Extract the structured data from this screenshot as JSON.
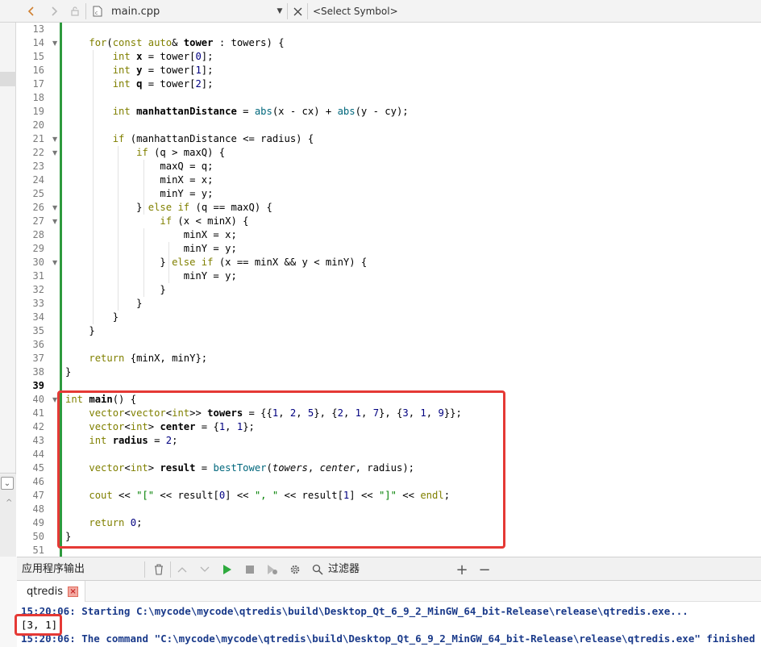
{
  "toolbar": {
    "file_name": "main.cpp",
    "symbol_placeholder": "<Select Symbol>",
    "icons": [
      "back-icon",
      "forward-icon",
      "lock-icon",
      "file-icon",
      "dropdown-icon",
      "close-icon"
    ]
  },
  "editor": {
    "current_line": 39,
    "lines": [
      {
        "n": 13,
        "fold": false
      },
      {
        "n": 14,
        "fold": true
      },
      {
        "n": 15,
        "fold": false
      },
      {
        "n": 16,
        "fold": false
      },
      {
        "n": 17,
        "fold": false
      },
      {
        "n": 18,
        "fold": false
      },
      {
        "n": 19,
        "fold": false
      },
      {
        "n": 20,
        "fold": false
      },
      {
        "n": 21,
        "fold": true
      },
      {
        "n": 22,
        "fold": true
      },
      {
        "n": 23,
        "fold": false
      },
      {
        "n": 24,
        "fold": false
      },
      {
        "n": 25,
        "fold": false
      },
      {
        "n": 26,
        "fold": true
      },
      {
        "n": 27,
        "fold": true
      },
      {
        "n": 28,
        "fold": false
      },
      {
        "n": 29,
        "fold": false
      },
      {
        "n": 30,
        "fold": true
      },
      {
        "n": 31,
        "fold": false
      },
      {
        "n": 32,
        "fold": false
      },
      {
        "n": 33,
        "fold": false
      },
      {
        "n": 34,
        "fold": false
      },
      {
        "n": 35,
        "fold": false
      },
      {
        "n": 36,
        "fold": false
      },
      {
        "n": 37,
        "fold": false
      },
      {
        "n": 38,
        "fold": false
      },
      {
        "n": 39,
        "fold": false
      },
      {
        "n": 40,
        "fold": true
      },
      {
        "n": 41,
        "fold": false
      },
      {
        "n": 42,
        "fold": false
      },
      {
        "n": 43,
        "fold": false
      },
      {
        "n": 44,
        "fold": false
      },
      {
        "n": 45,
        "fold": false
      },
      {
        "n": 46,
        "fold": false
      },
      {
        "n": 47,
        "fold": false
      },
      {
        "n": 48,
        "fold": false
      },
      {
        "n": 49,
        "fold": false
      },
      {
        "n": 50,
        "fold": false
      },
      {
        "n": 51,
        "fold": false
      }
    ],
    "code": [
      {
        "indent": 0,
        "tokens": []
      },
      {
        "indent": 4,
        "tokens": [
          [
            "kw",
            "for"
          ],
          [
            "",
            "("
          ],
          [
            "kw",
            "const"
          ],
          [
            "",
            " "
          ],
          [
            "kw",
            "auto"
          ],
          [
            "",
            "& "
          ],
          [
            "b",
            "tower"
          ],
          [
            "",
            " : towers) {"
          ]
        ]
      },
      {
        "indent": 8,
        "tokens": [
          [
            "ty",
            "int"
          ],
          [
            "",
            " "
          ],
          [
            "b",
            "x"
          ],
          [
            "",
            " = tower["
          ],
          [
            "num",
            "0"
          ],
          [
            "",
            "];"
          ]
        ]
      },
      {
        "indent": 8,
        "tokens": [
          [
            "ty",
            "int"
          ],
          [
            "",
            " "
          ],
          [
            "b",
            "y"
          ],
          [
            "",
            " = tower["
          ],
          [
            "num",
            "1"
          ],
          [
            "",
            "];"
          ]
        ]
      },
      {
        "indent": 8,
        "tokens": [
          [
            "ty",
            "int"
          ],
          [
            "",
            " "
          ],
          [
            "b",
            "q"
          ],
          [
            "",
            " = tower["
          ],
          [
            "num",
            "2"
          ],
          [
            "",
            "];"
          ]
        ]
      },
      {
        "indent": 0,
        "tokens": []
      },
      {
        "indent": 8,
        "tokens": [
          [
            "ty",
            "int"
          ],
          [
            "",
            " "
          ],
          [
            "b",
            "manhattanDistance"
          ],
          [
            "",
            " = "
          ],
          [
            "fn",
            "abs"
          ],
          [
            "",
            "(x - cx) + "
          ],
          [
            "fn",
            "abs"
          ],
          [
            "",
            "(y - cy);"
          ]
        ]
      },
      {
        "indent": 0,
        "tokens": []
      },
      {
        "indent": 8,
        "tokens": [
          [
            "kw",
            "if"
          ],
          [
            "",
            " (manhattanDistance <= radius) {"
          ]
        ]
      },
      {
        "indent": 12,
        "tokens": [
          [
            "kw",
            "if"
          ],
          [
            "",
            " (q > maxQ) {"
          ]
        ]
      },
      {
        "indent": 16,
        "tokens": [
          [
            "",
            "maxQ = q;"
          ]
        ]
      },
      {
        "indent": 16,
        "tokens": [
          [
            "",
            "minX = x;"
          ]
        ]
      },
      {
        "indent": 16,
        "tokens": [
          [
            "",
            "minY = y;"
          ]
        ]
      },
      {
        "indent": 12,
        "tokens": [
          [
            "",
            "} "
          ],
          [
            "kw",
            "else"
          ],
          [
            "",
            " "
          ],
          [
            "kw",
            "if"
          ],
          [
            "",
            " (q == maxQ) {"
          ]
        ]
      },
      {
        "indent": 16,
        "tokens": [
          [
            "kw",
            "if"
          ],
          [
            "",
            " (x < minX) {"
          ]
        ]
      },
      {
        "indent": 20,
        "tokens": [
          [
            "",
            "minX = x;"
          ]
        ]
      },
      {
        "indent": 20,
        "tokens": [
          [
            "",
            "minY = y;"
          ]
        ]
      },
      {
        "indent": 16,
        "tokens": [
          [
            "",
            "} "
          ],
          [
            "kw",
            "else"
          ],
          [
            "",
            " "
          ],
          [
            "kw",
            "if"
          ],
          [
            "",
            " (x == minX && y < minY) {"
          ]
        ]
      },
      {
        "indent": 20,
        "tokens": [
          [
            "",
            "minY = y;"
          ]
        ]
      },
      {
        "indent": 16,
        "tokens": [
          [
            "",
            "}"
          ]
        ]
      },
      {
        "indent": 12,
        "tokens": [
          [
            "",
            "}"
          ]
        ]
      },
      {
        "indent": 8,
        "tokens": [
          [
            "",
            "}"
          ]
        ]
      },
      {
        "indent": 4,
        "tokens": [
          [
            "",
            "}"
          ]
        ]
      },
      {
        "indent": 0,
        "tokens": []
      },
      {
        "indent": 4,
        "tokens": [
          [
            "kw",
            "return"
          ],
          [
            "",
            " {minX, minY};"
          ]
        ]
      },
      {
        "indent": 0,
        "tokens": [
          [
            "",
            "}"
          ]
        ]
      },
      {
        "indent": 0,
        "tokens": []
      },
      {
        "indent": 0,
        "tokens": [
          [
            "ty",
            "int"
          ],
          [
            "",
            " "
          ],
          [
            "b",
            "main"
          ],
          [
            "",
            "() {"
          ]
        ]
      },
      {
        "indent": 4,
        "tokens": [
          [
            "ty",
            "vector"
          ],
          [
            "",
            "<"
          ],
          [
            "ty",
            "vector"
          ],
          [
            "",
            "<"
          ],
          [
            "ty",
            "int"
          ],
          [
            "",
            ">> "
          ],
          [
            "b",
            "towers"
          ],
          [
            "",
            " = {{"
          ],
          [
            "num",
            "1"
          ],
          [
            "",
            ", "
          ],
          [
            "num",
            "2"
          ],
          [
            "",
            ", "
          ],
          [
            "num",
            "5"
          ],
          [
            "",
            "}, {"
          ],
          [
            "num",
            "2"
          ],
          [
            "",
            ", "
          ],
          [
            "num",
            "1"
          ],
          [
            "",
            ", "
          ],
          [
            "num",
            "7"
          ],
          [
            "",
            "}, {"
          ],
          [
            "num",
            "3"
          ],
          [
            "",
            ", "
          ],
          [
            "num",
            "1"
          ],
          [
            "",
            ", "
          ],
          [
            "num",
            "9"
          ],
          [
            "",
            "}};"
          ]
        ]
      },
      {
        "indent": 4,
        "tokens": [
          [
            "ty",
            "vector"
          ],
          [
            "",
            "<"
          ],
          [
            "ty",
            "int"
          ],
          [
            "",
            "> "
          ],
          [
            "b",
            "center"
          ],
          [
            "",
            " = {"
          ],
          [
            "num",
            "1"
          ],
          [
            "",
            ", "
          ],
          [
            "num",
            "1"
          ],
          [
            "",
            "};"
          ]
        ]
      },
      {
        "indent": 4,
        "tokens": [
          [
            "ty",
            "int"
          ],
          [
            "",
            " "
          ],
          [
            "b",
            "radius"
          ],
          [
            "",
            " = "
          ],
          [
            "num",
            "2"
          ],
          [
            "",
            ";"
          ]
        ]
      },
      {
        "indent": 0,
        "tokens": []
      },
      {
        "indent": 4,
        "tokens": [
          [
            "ty",
            "vector"
          ],
          [
            "",
            "<"
          ],
          [
            "ty",
            "int"
          ],
          [
            "",
            "> "
          ],
          [
            "b",
            "result"
          ],
          [
            "",
            " = "
          ],
          [
            "fn",
            "bestTower"
          ],
          [
            "",
            "("
          ],
          [
            "it",
            "towers"
          ],
          [
            "",
            ", "
          ],
          [
            "it",
            "center"
          ],
          [
            "",
            ", radius);"
          ]
        ]
      },
      {
        "indent": 0,
        "tokens": []
      },
      {
        "indent": 4,
        "tokens": [
          [
            "ty",
            "cout"
          ],
          [
            "",
            " << "
          ],
          [
            "str",
            "\"[\""
          ],
          [
            "",
            " << result["
          ],
          [
            "num",
            "0"
          ],
          [
            "",
            "] << "
          ],
          [
            "str",
            "\", \""
          ],
          [
            "",
            " << result["
          ],
          [
            "num",
            "1"
          ],
          [
            "",
            "] << "
          ],
          [
            "str",
            "\"]\""
          ],
          [
            "",
            " << "
          ],
          [
            "ty",
            "endl"
          ],
          [
            "",
            ";"
          ]
        ]
      },
      {
        "indent": 0,
        "tokens": []
      },
      {
        "indent": 4,
        "tokens": [
          [
            "kw",
            "return"
          ],
          [
            "",
            " "
          ],
          [
            "num",
            "0"
          ],
          [
            "",
            ";"
          ]
        ]
      },
      {
        "indent": 0,
        "tokens": [
          [
            "",
            "}"
          ]
        ]
      },
      {
        "indent": 0,
        "tokens": []
      }
    ]
  },
  "output": {
    "pane_title": "应用程序输出",
    "filter_label": "过滤器",
    "tab_label": "qtredis",
    "lines": [
      {
        "style": "blue",
        "text": "15:20:06: Starting C:\\mycode\\mycode\\qtredis\\build\\Desktop_Qt_6_9_2_MinGW_64_bit-Release\\release\\qtredis.exe..."
      },
      {
        "style": "plain",
        "text": "[3, 1]"
      },
      {
        "style": "blue",
        "text": "15:20:06: The command \"C:\\mycode\\mycode\\qtredis\\build\\Desktop_Qt_6_9_2_MinGW_64_bit-Release\\release\\qtredis.exe\" finished"
      }
    ]
  },
  "colors": {
    "highlight_box": "#e53935",
    "fold_bar": "#2e9a3e",
    "keyword": "#808000",
    "number": "#000080",
    "string": "#008000",
    "function": "#00677c",
    "output_blue": "#1a3a8a"
  }
}
